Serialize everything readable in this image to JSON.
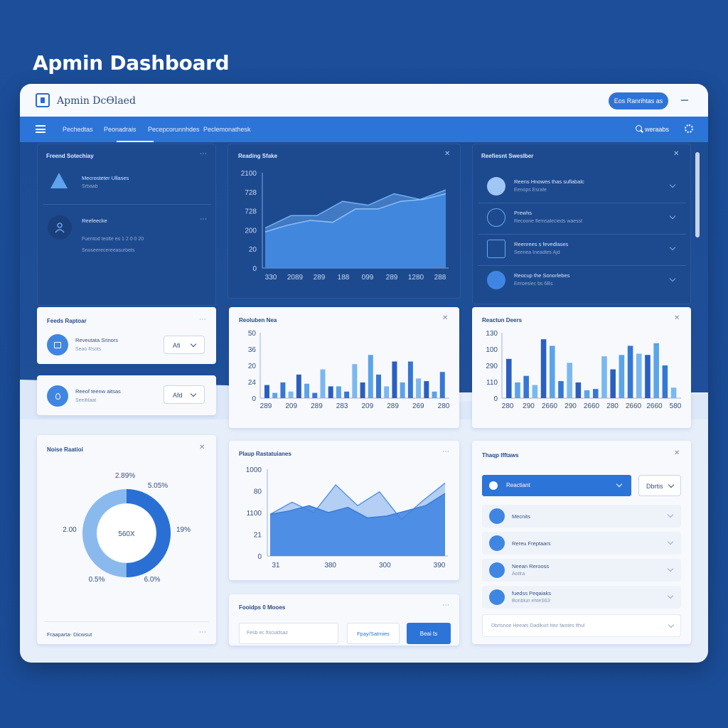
{
  "page_heading": "Apmin Dashboard",
  "window": {
    "app_title": "Apmin DcƟlaed",
    "primary_button": "Eos Ranrihtas as",
    "search_label": "weraabs"
  },
  "nav": {
    "items": [
      "Pechedtas",
      "Peonadrais",
      "Pecepcorunnhdes",
      "Peclemonathesk"
    ]
  },
  "cards": {
    "friend_selection": {
      "title": "Freend Sotechiay",
      "row1_title": "Mecrosteter Ullases",
      "row1_sub": "Srbaab",
      "row2_title": "Reefeecke",
      "row2_line1": "Fuentod teolte es 1 2 0 0 20",
      "row2_line2": "Snoseerecereeasurbets"
    },
    "reading_state": {
      "title": "Reading Sfake"
    },
    "recent_searches": {
      "title": "Reefiesnt Sweslber",
      "rows": [
        {
          "title": "Reens Hnowes thas suflabalc",
          "sub": "Eenops Esrafe"
        },
        {
          "title": "Prewhs",
          "sub": "Recoone flemsalecieds waesst"
        },
        {
          "title": "Reenrees s fevedlases",
          "sub": "Seenea Ineadtes Ajd"
        },
        {
          "title": "Reocup the Sonorlebes",
          "sub": "Eeroeslec bs 6Bs"
        }
      ]
    },
    "feeds_report": {
      "title": "Feeds Raptoar",
      "row_title": "Reveutata Srinors",
      "row_sub": "Seao Rsots",
      "select": "Afi"
    },
    "recent_items": {
      "row_title": "Reeof teenw aitsas",
      "row_sub": "Seeifitaat",
      "select": "Afd"
    },
    "resolution_new": {
      "title": "Reoluben Nea"
    },
    "reaction_deers": {
      "title": "Reactun Deers"
    },
    "noise_ratio": {
      "title": "Noise Raatioi",
      "footer": "Fraaparta- Dicwsut"
    },
    "piston_rates": {
      "title": "Plaup Rastatuianes"
    },
    "foreign_filter": {
      "title": "Fooidps 0 Mooes",
      "input_placeholder": "Fesb ec ftsculdsaz",
      "secondary_button": "Fpay/Satmies",
      "primary_button": "Beai ts"
    },
    "thaup_items": {
      "title": "Thaqp lfftaws",
      "select_primary": "Reactiant",
      "select_secondary": "Dbrtis",
      "rows": [
        {
          "title": "Mecnits",
          "sub": ""
        },
        {
          "title": "Rereu Freptaars",
          "sub": ""
        },
        {
          "title": "Neean Rerooss",
          "sub": "Aotlra"
        },
        {
          "title": "fuedss Peqaiaks",
          "sub": "Bonblun ehteS63"
        }
      ],
      "footer_input": "Dbrtsnoe Heeats Dadlkurt Iteir faiotes lfhul"
    }
  },
  "chart_data": [
    {
      "type": "area",
      "title": "Reading Sfake",
      "y_tick_labels": [
        "2100",
        "728",
        "728",
        "200",
        "20",
        "0"
      ],
      "x_tick_labels": [
        "330",
        "2089",
        "289",
        "188",
        "099",
        "289",
        "1280",
        "288"
      ],
      "series": [
        {
          "values": [
            42,
            55,
            55,
            70,
            66,
            78,
            72,
            82
          ]
        },
        {
          "values": [
            38,
            45,
            50,
            48,
            62,
            62,
            70,
            72,
            78
          ]
        }
      ]
    },
    {
      "type": "bar",
      "title": "Reoluben Nea",
      "y_tick_labels": [
        "50",
        "36",
        "20",
        "24",
        "0"
      ],
      "x_tick_labels": [
        "289",
        "209",
        "289",
        "283",
        "209",
        "289",
        "269",
        "280"
      ],
      "values": [
        20,
        8,
        24,
        10,
        36,
        22,
        8,
        44,
        18,
        18,
        10,
        52,
        24,
        66,
        36,
        18,
        56,
        24,
        56,
        30,
        26,
        10,
        40
      ]
    },
    {
      "type": "bar",
      "title": "Reactun Deers",
      "y_tick_labels": [
        "130",
        "100",
        "290",
        "110",
        "0"
      ],
      "x_tick_labels": [
        "280",
        "290",
        "2660",
        "290",
        "2660",
        "280",
        "2660",
        "2660",
        "580"
      ],
      "values": [
        60,
        24,
        34,
        20,
        90,
        80,
        26,
        54,
        24,
        12,
        14,
        64,
        44,
        66,
        80,
        68,
        66,
        84,
        50,
        16
      ]
    },
    {
      "type": "pie",
      "title": "Noise Raatioi",
      "center_label": "560X",
      "slice_labels": [
        "2.89%",
        "5.05%",
        "19%",
        "0.5%",
        "6.0%",
        "2.00"
      ],
      "values": [
        50,
        50
      ]
    },
    {
      "type": "area",
      "title": "Plaup Rastatuianes",
      "y_tick_labels": [
        "1000",
        "80",
        "1100",
        "21",
        "0"
      ],
      "x_tick_labels": [
        "31",
        "380",
        "300",
        "390"
      ],
      "series": [
        {
          "values": [
            48,
            62,
            50,
            82,
            58,
            74,
            42,
            64,
            84
          ]
        },
        {
          "values": [
            48,
            52,
            58,
            50,
            56,
            44,
            46,
            52,
            58,
            72
          ]
        }
      ]
    }
  ],
  "colors": {
    "brand_blue": "#2d74d8",
    "dark_panel": "#1d4a8f",
    "light_panel": "#f7f9fd"
  }
}
